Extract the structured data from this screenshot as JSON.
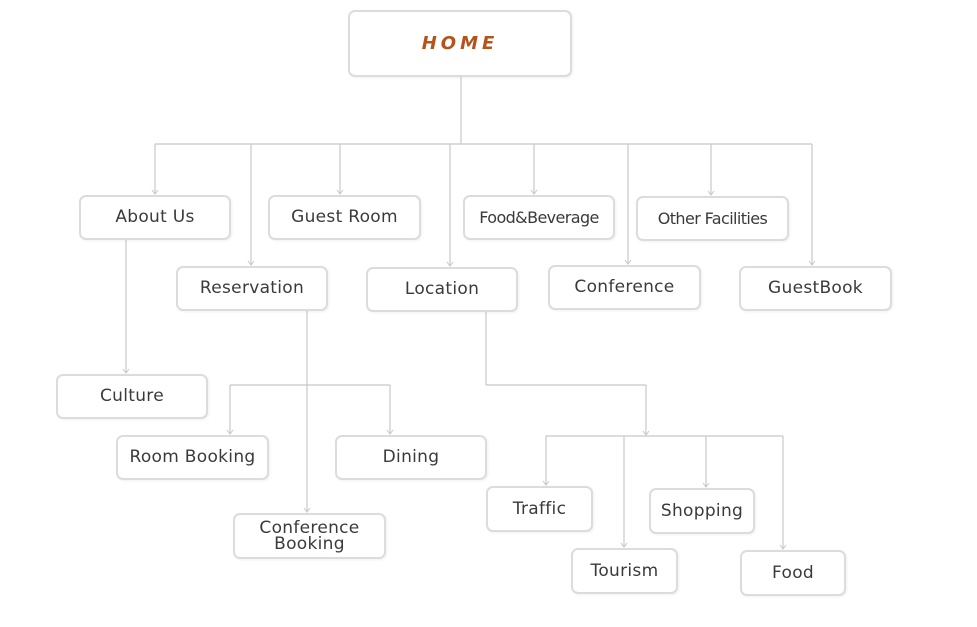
{
  "colors": {
    "root_text": "#b5541a",
    "node_text": "#3a3a3a",
    "border": "#dcdcdc",
    "connector": "#c8c8c8"
  },
  "home": "HOME",
  "level1": {
    "about_us": "About Us",
    "guest_room": "Guest Room",
    "food_beverage": "Food&Beverage",
    "other_facilities": "Other Facilities",
    "reservation": "Reservation",
    "location": "Location",
    "conference": "Conference",
    "guestbook": "GuestBook"
  },
  "about_children": {
    "culture": "Culture"
  },
  "reservation_children": {
    "room_booking": "Room Booking",
    "dining": "Dining",
    "conference_booking": "Conference\nBooking"
  },
  "location_children": {
    "traffic": "Traffic",
    "shopping": "Shopping",
    "tourism": "Tourism",
    "food": "Food"
  }
}
